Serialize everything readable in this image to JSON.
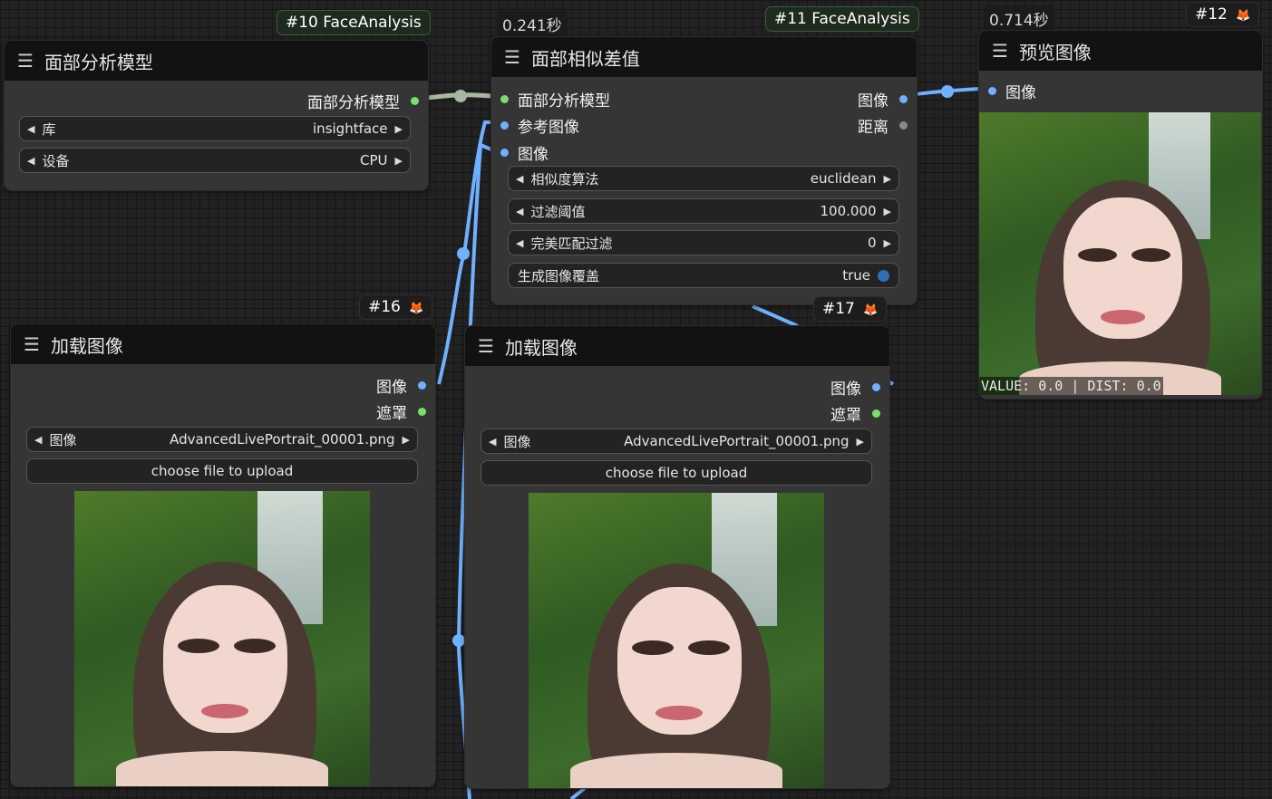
{
  "nodes": {
    "n10": {
      "badge": "#10 FaceAnalysis",
      "title": "面部分析模型",
      "output": "面部分析模型",
      "widgets": [
        {
          "label": "库",
          "value": "insightface"
        },
        {
          "label": "设备",
          "value": "CPU"
        }
      ]
    },
    "n11": {
      "badge": "#11 FaceAnalysis",
      "time": "0.241秒",
      "title": "面部相似差值",
      "inputs": [
        "面部分析模型",
        "参考图像",
        "图像"
      ],
      "outputs": [
        "图像",
        "距离"
      ],
      "widgets": [
        {
          "label": "相似度算法",
          "value": "euclidean"
        },
        {
          "label": "过滤阈值",
          "value": "100.000"
        },
        {
          "label": "完美匹配过滤",
          "value": "0"
        },
        {
          "label": "生成图像覆盖",
          "value": "true"
        }
      ]
    },
    "n12": {
      "badge": "#12",
      "time": "0.714秒",
      "title": "预览图像",
      "input": "图像",
      "readout": "VALUE: 0.0 | DIST: 0.0"
    },
    "n16": {
      "badge": "#16",
      "title": "加载图像",
      "outputs": [
        "图像",
        "遮罩"
      ],
      "image_label": "图像",
      "image_value": "AdvancedLivePortrait_00001.png",
      "upload": "choose file to upload"
    },
    "n17": {
      "badge": "#17",
      "title": "加载图像",
      "outputs": [
        "图像",
        "遮罩"
      ],
      "image_label": "图像",
      "image_value": "AdvancedLivePortrait_00001.png",
      "upload": "choose file to upload"
    }
  },
  "icons": {
    "menu": "☰",
    "left_arrow": "◀",
    "right_arrow": "▶",
    "fox": "🦊"
  },
  "colors": {
    "image_link": "#6fb0ff",
    "model_link": "#a8b8a0",
    "node_bg": "#353535",
    "title_bg": "#121212"
  }
}
